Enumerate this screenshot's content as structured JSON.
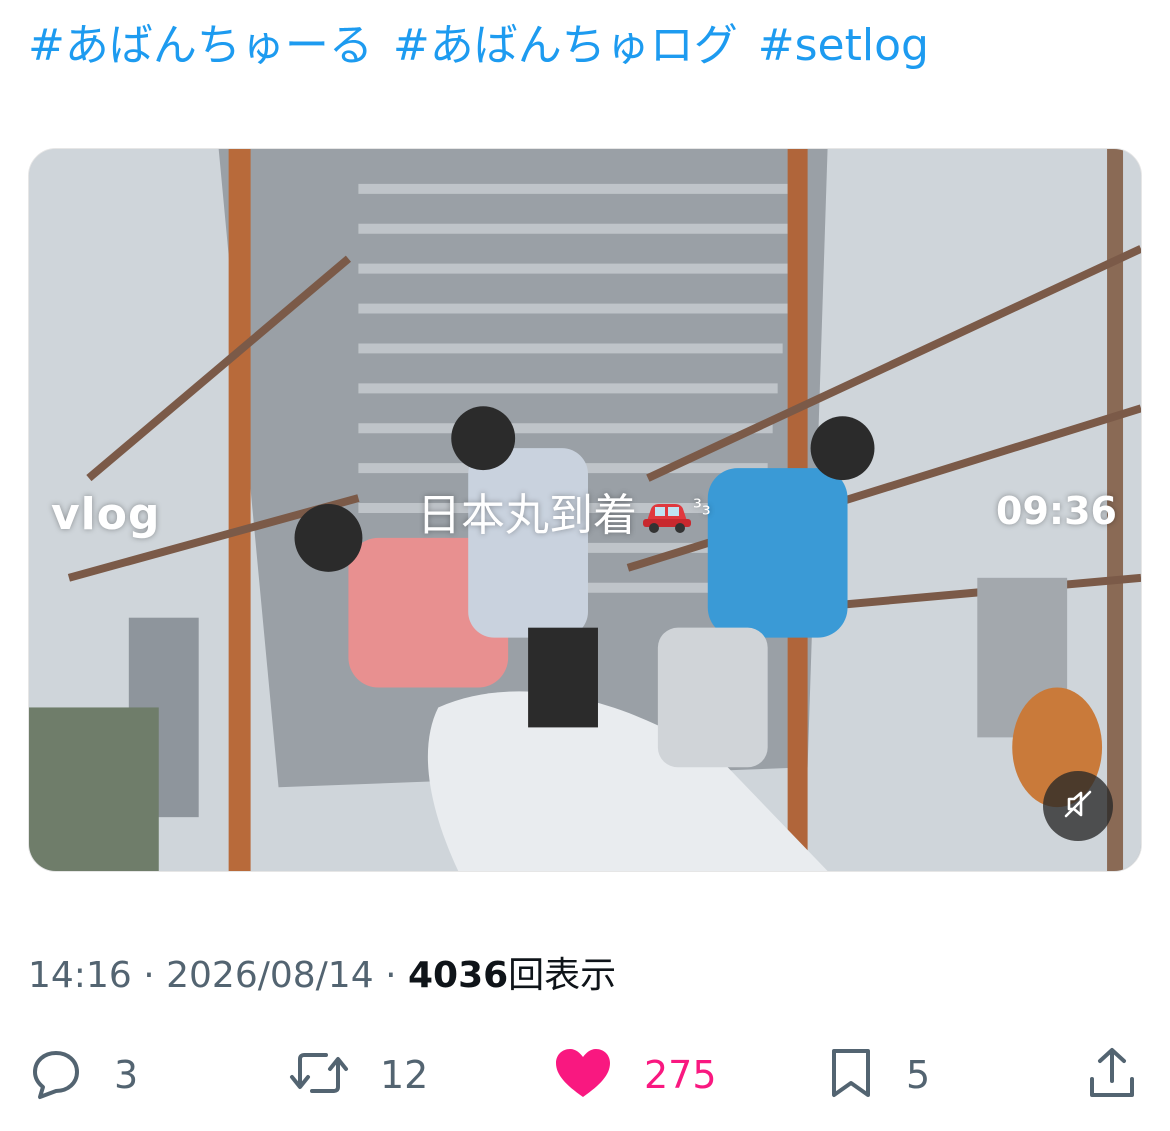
{
  "hashtags": [
    "#あばんちゅーる",
    "#あばんちゅログ",
    "#setlog"
  ],
  "video": {
    "overlay_left": "vlog",
    "caption": "日本丸到着",
    "caption_suffix": "³₃",
    "time_display": "09:36",
    "mute_icon": "speaker-muted-icon"
  },
  "meta": {
    "time": "14:16",
    "separator": "·",
    "date": "2026/08/14",
    "views_count": "4036",
    "views_label": "回表示"
  },
  "actions": {
    "reply_count": "3",
    "repost_count": "12",
    "like_count": "275",
    "bookmark_count": "5"
  },
  "colors": {
    "link": "#1d9bf0",
    "like": "#f91880",
    "muted_text": "#536471"
  }
}
